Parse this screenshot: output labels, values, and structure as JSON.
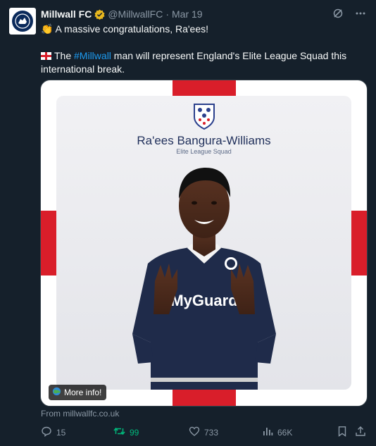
{
  "tweet": {
    "author_name": "Millwall FC",
    "handle": "@MillwallFC",
    "separator": "·",
    "date": "Mar 19",
    "line1": "👏 A massive congratulations, Ra'ees!",
    "line2_pre": "The ",
    "hashtag": "#Millwall",
    "line2_post": " man will represent England's Elite League Squad this international break."
  },
  "media": {
    "player_name": "Ra'ees Bangura-Williams",
    "squad": "Elite League Squad",
    "shirt_sponsor": "MyGuard",
    "more_info_label": "More info!"
  },
  "source": "From millwallfc.co.uk",
  "actions": {
    "replies": "15",
    "reposts": "99",
    "likes": "733",
    "views": "66K"
  },
  "colors": {
    "background": "#15202b",
    "accent": "#1d9bf0",
    "repost": "#00ba7c",
    "muted": "#8b98a5",
    "flag_red": "#d91e2a"
  },
  "icons": [
    "millwall-logo",
    "verified-badge",
    "grok-icon",
    "more-icon",
    "england-flag",
    "england-crest",
    "globe-icon",
    "reply-icon",
    "repost-icon",
    "like-icon",
    "views-icon",
    "bookmark-icon",
    "share-icon"
  ]
}
